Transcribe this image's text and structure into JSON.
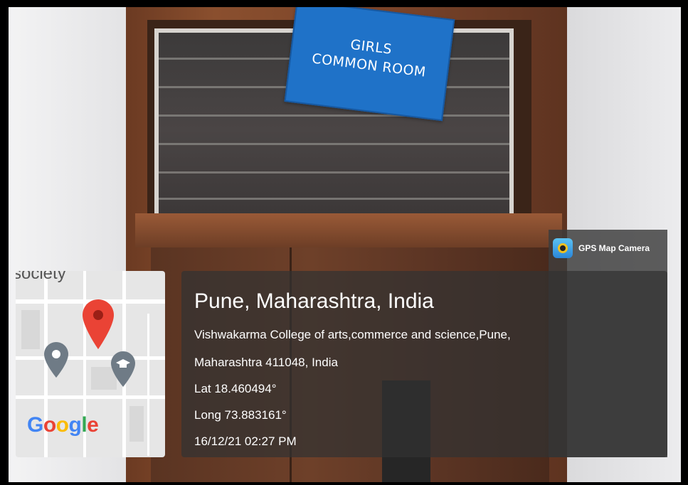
{
  "sign": {
    "line1": "GIRLS",
    "line2": "COMMON ROOM"
  },
  "app": {
    "name": "GPS Map Camera",
    "icon": "gps-map-camera-icon"
  },
  "map": {
    "label_partial": "society",
    "logo": "Google",
    "pins": [
      "location-pin-icon",
      "graduation-cap-pin-icon",
      "gray-pin-icon"
    ]
  },
  "location": {
    "title": "Pune, Maharashtra, India",
    "address_line1": "Vishwakarma College of arts,commerce and science,Pune,",
    "address_line2": "Maharashtra 411048, India",
    "lat": "Lat 18.460494°",
    "long": "Long 73.883161°",
    "timestamp": "16/12/21 02:27 PM"
  },
  "colors": {
    "sign_blue": "#1f72c8",
    "pin_red": "#EA4335",
    "pin_gray": "#6f7b86",
    "overlay_dark": "#323232"
  }
}
